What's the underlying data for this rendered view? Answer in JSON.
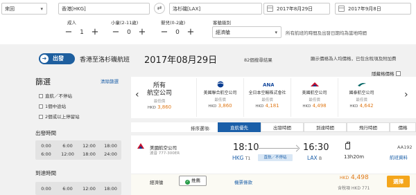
{
  "search": {
    "trip_type": "來回",
    "origin": "香港[HKG]",
    "destination": "洛杉磯[LAX]",
    "depart_date": "2017年8月29日",
    "return_date": "2017年9月8日",
    "adult_label": "成人",
    "adult_count": "1",
    "child_label": "小童",
    "child_note": "(2-11歲)",
    "child_count": "0",
    "infant_label": "嬰兒",
    "infant_note": "(0-2歲)",
    "infant_count": "0",
    "class_label": "客艙級別",
    "class_value": "經濟艙",
    "time_note": "所有航班的時間及出發日期均為當地時間"
  },
  "banner": {
    "depart_label": "出發",
    "route": "香港至洛杉磯航班",
    "date": "2017年08月29日",
    "results": "82個搜尋結果",
    "price_note": "顯示價格為人均價格，已包含稅項及附加費",
    "hidden_price_label": "隱藏格價格"
  },
  "filters": {
    "title": "篩選",
    "clear": "清除篩選",
    "stops": [
      "直航／不停站",
      "1個中途站",
      "2個或以上停留站"
    ],
    "depart_time_title": "出發時間",
    "arrive_time_title": "到達時間",
    "depart_times": [
      [
        "0:00",
        "6:00",
        "12:00",
        "18:00"
      ],
      [
        "6:00",
        "12:00",
        "18:00",
        "24:00"
      ]
    ],
    "arrive_times": [
      [
        "0:00",
        "6:00",
        "12:00",
        "18:00"
      ]
    ]
  },
  "airlines": {
    "all_label_1": "所有",
    "all_label_2": "航空公司",
    "all_price": "3,860",
    "currency": "HKD",
    "from_label": "最低價",
    "items": [
      {
        "name": "美國聯合航空公司",
        "price": "3,860",
        "color": "#0a3d91"
      },
      {
        "name": "全日本空輸株式會社",
        "price": "4,181",
        "color": "#1a4d9f"
      },
      {
        "name": "美國航空公司",
        "price": "4,498",
        "color": "#c8102e"
      },
      {
        "name": "國泰航空公司",
        "price": "4,642",
        "color": "#006564"
      }
    ]
  },
  "sort": {
    "label": "排序選項:",
    "options": [
      "直航優先",
      "出發時間",
      "到達時間",
      "飛行時間",
      "價格"
    ]
  },
  "flight": {
    "airline": "美國航空公司",
    "aircraft": "波音 777-300ER",
    "depart_time": "18:10",
    "depart_airport": "HKG",
    "depart_terminal": "T1",
    "arrive_time": "16:30",
    "arrive_airport": "LAX",
    "arrive_terminal": "B",
    "direct_label": "直航／不停站",
    "duration": "13h20m",
    "flight_number": "AA192",
    "detail_link": "航班資料",
    "cabin": "經濟艙",
    "recommend": "推薦",
    "terms": "機票條款",
    "currency": "HKD",
    "price": "4,498",
    "tax_note": "含稅項 HKD 771",
    "select": "選擇"
  }
}
